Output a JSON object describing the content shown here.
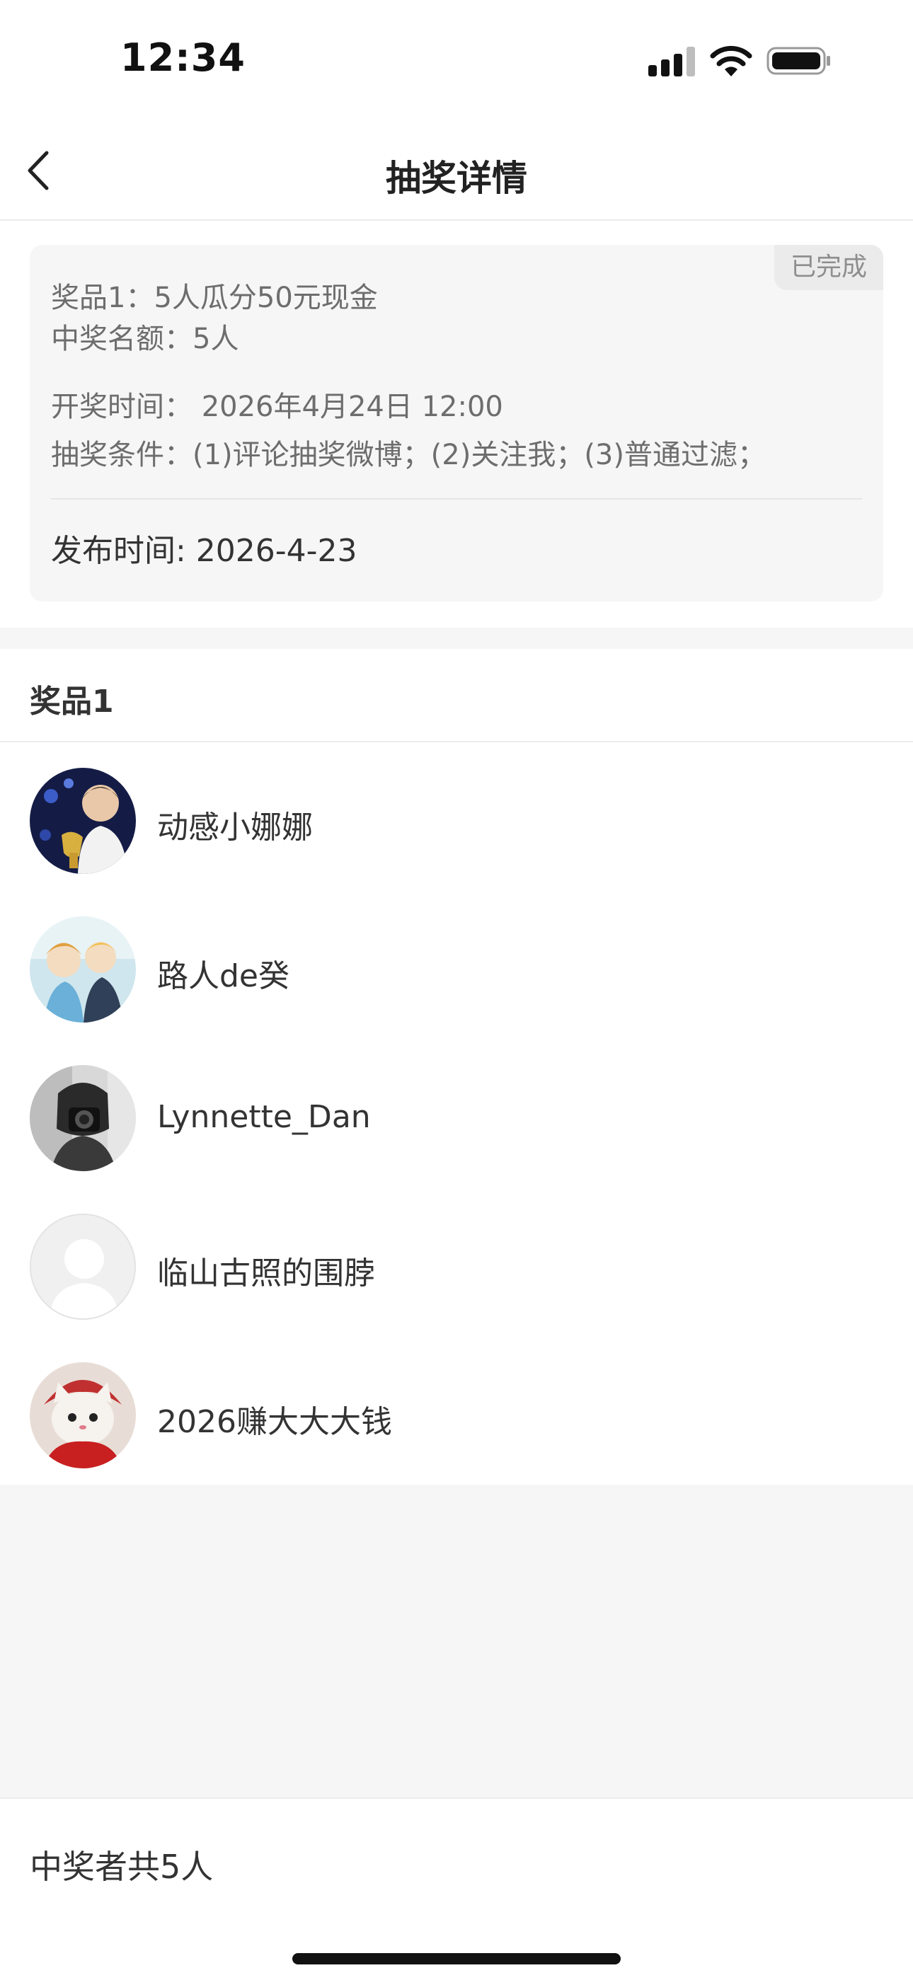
{
  "status_bar": {
    "time": "12:34"
  },
  "nav": {
    "title": "抽奖详情"
  },
  "info": {
    "status_badge": "已完成",
    "prize_line": "奖品1：5人瓜分50元现金",
    "winners_quota": "中奖名额：5人",
    "draw_time": "开奖时间： 2026年4月24日 12:00",
    "conditions": "抽奖条件：(1)评论抽奖微博；(2)关注我；(3)普通过滤；",
    "publish_time": "发布时间: 2026-4-23"
  },
  "prize_section": {
    "title": "奖品1",
    "winners": [
      {
        "name": "动感小娜娜"
      },
      {
        "name": "路人de癸"
      },
      {
        "name": "Lynnette_Dan"
      },
      {
        "name": "临山古照的围脖"
      },
      {
        "name": "2026赚大大大钱"
      }
    ]
  },
  "footer": {
    "winner_count": "中奖者共5人"
  },
  "colors": {
    "background": "#f6f6f6",
    "card": "#f6f6f6",
    "text_primary": "#222222",
    "text_secondary": "#6d6d6d"
  }
}
